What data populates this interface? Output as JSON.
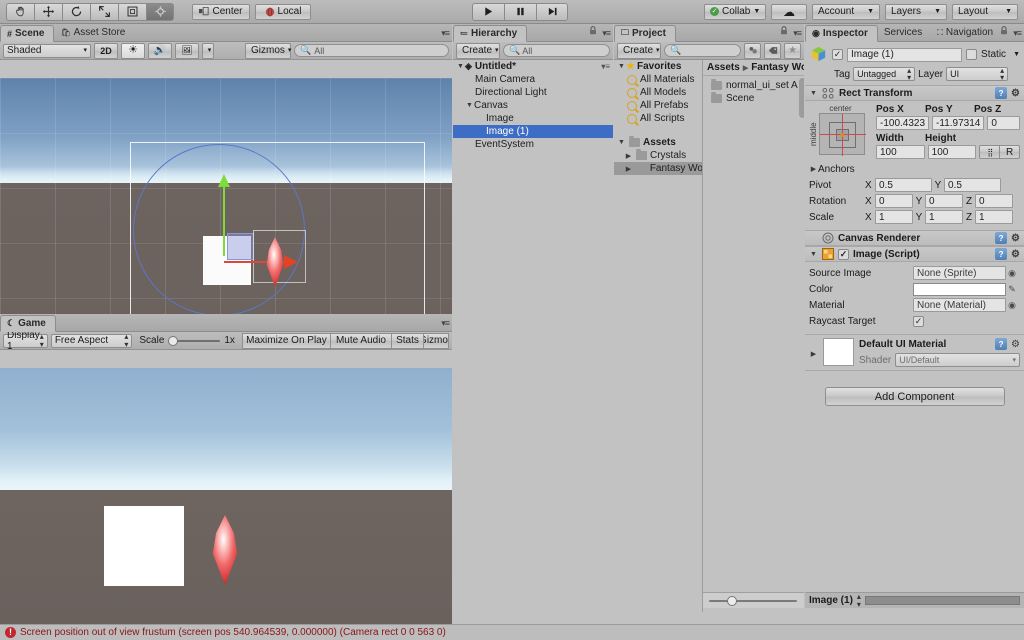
{
  "toolbar": {
    "tools": [
      {
        "name": "hand-tool",
        "glyph": "✋",
        "active": false
      },
      {
        "name": "move-tool",
        "glyph": "✥",
        "active": false
      },
      {
        "name": "rotate-tool",
        "glyph": "⟳",
        "active": false
      },
      {
        "name": "scale-tool",
        "glyph": "⤢",
        "active": false
      },
      {
        "name": "rect-tool",
        "glyph": "▣",
        "active": false
      },
      {
        "name": "transform-tool",
        "glyph": "◈",
        "active": true
      }
    ],
    "pivot_label": "Center",
    "space_label": "Local",
    "play_label": "▶",
    "pause_label": "❚❚",
    "step_label": "▶❙",
    "collab_label": "Collab",
    "cloud_label": "☁",
    "account_label": "Account",
    "layers_label": "Layers",
    "layout_label": "Layout"
  },
  "scene": {
    "tabs": [
      {
        "label": "Scene",
        "active": true,
        "icon": "grid-icon"
      },
      {
        "label": "Asset Store",
        "active": false,
        "icon": "store-icon"
      }
    ],
    "draw_mode": "Shaded",
    "mode_2d": "2D",
    "lighting_icon": "sun-icon",
    "audio_icon": "speaker-icon",
    "fx_icon": "image-icon",
    "gizmos_label": "Gizmos",
    "search_placeholder": "All"
  },
  "game": {
    "tab_label": "Game",
    "display_label": "Display 1",
    "aspect_label": "Free Aspect",
    "scale_label": "Scale",
    "scale_value": "1x",
    "maximize_label": "Maximize On Play",
    "mute_label": "Mute Audio",
    "stats_label": "Stats",
    "gizmos_label": "Gizmos"
  },
  "hierarchy": {
    "tab_label": "Hierarchy",
    "create_label": "Create",
    "search_placeholder": "All",
    "items": [
      {
        "label": "Untitled*",
        "depth": 0,
        "arrow": "down",
        "icon": "scene-icon",
        "selected": false,
        "bold": true
      },
      {
        "label": "Main Camera",
        "depth": 1,
        "arrow": "none",
        "selected": false
      },
      {
        "label": "Directional Light",
        "depth": 1,
        "arrow": "none",
        "selected": false
      },
      {
        "label": "Canvas",
        "depth": 1,
        "arrow": "down",
        "selected": false
      },
      {
        "label": "Image",
        "depth": 2,
        "arrow": "none",
        "selected": false
      },
      {
        "label": "Image (1)",
        "depth": 2,
        "arrow": "none",
        "selected": true
      },
      {
        "label": "EventSystem",
        "depth": 1,
        "arrow": "none",
        "selected": false
      }
    ]
  },
  "project": {
    "tab_label": "Project",
    "create_label": "Create",
    "search_placeholder": "",
    "tree": [
      {
        "label": "Favorites",
        "depth": 0,
        "arrow": "down",
        "icon": "star-icon",
        "bold": true,
        "selected": false
      },
      {
        "label": "All Materials",
        "depth": 1,
        "arrow": "none",
        "icon": "magnifier-icon",
        "selected": false
      },
      {
        "label": "All Models",
        "depth": 1,
        "arrow": "none",
        "icon": "magnifier-icon",
        "selected": false
      },
      {
        "label": "All Prefabs",
        "depth": 1,
        "arrow": "none",
        "icon": "magnifier-icon",
        "selected": false
      },
      {
        "label": "All Scripts",
        "depth": 1,
        "arrow": "none",
        "icon": "magnifier-icon",
        "selected": false
      },
      {
        "label": "Assets",
        "depth": 0,
        "arrow": "down",
        "icon": "folder-icon",
        "bold": true,
        "selected": false
      },
      {
        "label": "Crystals",
        "depth": 1,
        "arrow": "right",
        "icon": "folder-icon",
        "selected": false
      },
      {
        "label": "Fantasy Wo",
        "depth": 1,
        "arrow": "right",
        "icon": "folder-icon",
        "selected": true
      }
    ],
    "breadcrumb": [
      "Assets",
      "Fantasy Wo"
    ],
    "contents": [
      {
        "label": "normal_ui_set A",
        "icon": "folder-icon"
      },
      {
        "label": "Scene",
        "icon": "folder-icon"
      }
    ],
    "zoom_slider": 22
  },
  "inspector": {
    "tabs": [
      {
        "label": "Inspector",
        "active": true,
        "icon": "info-icon"
      },
      {
        "label": "Services",
        "active": false,
        "icon": ""
      },
      {
        "label": "Navigation",
        "active": false,
        "icon": "nav-icon"
      }
    ],
    "object_name": "Image (1)",
    "enabled": true,
    "static_label": "Static",
    "tag_label": "Tag",
    "tag_value": "Untagged",
    "layer_label": "Layer",
    "layer_value": "UI",
    "rect_transform": {
      "title": "Rect Transform",
      "anchor_preset_top": "center",
      "anchor_preset_left": "middle",
      "pos_x_label": "Pos X",
      "pos_x": "-100.4323",
      "pos_y_label": "Pos Y",
      "pos_y": "-11.97314",
      "pos_z_label": "Pos Z",
      "pos_z": "0",
      "width_label": "Width",
      "width": "100",
      "height_label": "Height",
      "height": "100",
      "blueprint_label": "⣿",
      "raw_label": "R",
      "anchors_label": "Anchors",
      "pivot_label": "Pivot",
      "pivot_x": "0.5",
      "pivot_y": "0.5",
      "rotation_label": "Rotation",
      "rot_x": "0",
      "rot_y": "0",
      "rot_z": "0",
      "scale_label": "Scale",
      "scale_x": "1",
      "scale_y": "1",
      "scale_z": "1"
    },
    "canvas_renderer": {
      "title": "Canvas Renderer"
    },
    "image_script": {
      "title": "Image (Script)",
      "enabled": true,
      "source_image_label": "Source Image",
      "source_image_value": "None (Sprite)",
      "color_label": "Color",
      "color_value": "#FFFFFF",
      "material_label": "Material",
      "material_value": "None (Material)",
      "raycast_label": "Raycast Target",
      "raycast_checked": true
    },
    "material": {
      "title": "Default UI Material",
      "shader_label": "Shader",
      "shader_value": "UI/Default"
    },
    "add_component_label": "Add Component"
  },
  "footer": {
    "selected_object": "Image (1)"
  },
  "statusbar": {
    "message": "Screen position out of view frustum (screen pos 540.964539, 0.000000) (Camera rect 0 0 563 0)",
    "icon": "error-icon"
  },
  "colors": {
    "selection_blue": "#3d6dc4",
    "error_red": "#8a1414",
    "panel_gray": "#c2c2c2",
    "crystal_red": "#d22a2a"
  }
}
